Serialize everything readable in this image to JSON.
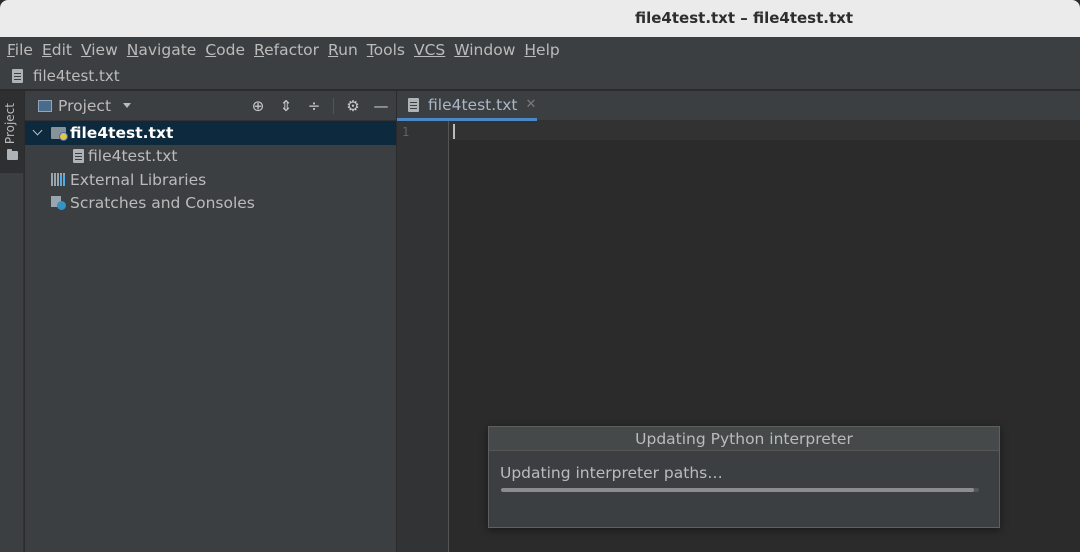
{
  "window": {
    "title": "file4test.txt – file4test.txt"
  },
  "menu": [
    {
      "mnemonic": "F",
      "rest": "ile"
    },
    {
      "mnemonic": "E",
      "rest": "dit"
    },
    {
      "mnemonic": "V",
      "rest": "iew"
    },
    {
      "mnemonic": "N",
      "rest": "avigate"
    },
    {
      "mnemonic": "C",
      "rest": "ode"
    },
    {
      "mnemonic": "R",
      "rest": "efactor"
    },
    {
      "mnemonic": "R",
      "rest": "un",
      "pre": ""
    },
    {
      "mnemonic": "T",
      "rest": "ools"
    },
    {
      "mnemonic": "VCS",
      "rest": ""
    },
    {
      "mnemonic": "W",
      "rest": "indow"
    },
    {
      "mnemonic": "H",
      "rest": "elp"
    }
  ],
  "navbar": {
    "crumb": "file4test.txt"
  },
  "toolstrip": {
    "project_label": "Project"
  },
  "project_panel": {
    "title": "Project",
    "tree": [
      {
        "label": "file4test.txt",
        "icon": "project-folder-icon",
        "expanded": true,
        "selected": true
      },
      {
        "label": "file4test.txt",
        "icon": "text-file-icon"
      },
      {
        "label": "External Libraries",
        "icon": "library-icon"
      },
      {
        "label": "Scratches and Consoles",
        "icon": "scratches-icon"
      }
    ]
  },
  "editor": {
    "tab_label": "file4test.txt",
    "line_numbers": [
      "1"
    ]
  },
  "dialog": {
    "title": "Updating Python interpreter",
    "message": "Updating interpreter paths…",
    "progress": 0.99
  },
  "colors": {
    "accent": "#4a88c7",
    "selection": "#0d293e",
    "panel": "#3c3f41",
    "editor_bg": "#2b2b2b"
  }
}
